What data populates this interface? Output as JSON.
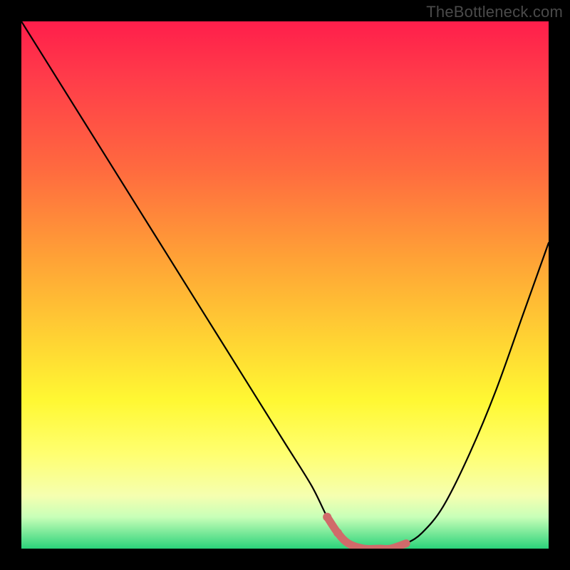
{
  "watermark": "TheBottleneck.com",
  "chart_data": {
    "type": "line",
    "title": "",
    "xlabel": "",
    "ylabel": "",
    "xlim": [
      0,
      100
    ],
    "ylim": [
      0,
      100
    ],
    "grid": false,
    "legend": false,
    "series": [
      {
        "name": "bottleneck-curve",
        "x": [
          0,
          5,
          10,
          15,
          20,
          25,
          30,
          35,
          40,
          45,
          50,
          55,
          58,
          60,
          62,
          65,
          68,
          70,
          73,
          76,
          80,
          85,
          90,
          95,
          100
        ],
        "y": [
          100,
          92,
          84,
          76,
          68,
          60,
          52,
          44,
          36,
          28,
          20,
          12,
          6,
          3,
          1,
          0,
          0,
          0,
          1,
          3,
          8,
          18,
          30,
          44,
          58
        ]
      }
    ],
    "highlight": {
      "name": "optimal-range",
      "color": "#d06a6a",
      "x": [
        58,
        60,
        62,
        65,
        68,
        70,
        73
      ],
      "y": [
        6,
        3,
        1,
        0,
        0,
        0,
        1
      ]
    },
    "gradient_stops": [
      {
        "pos": 0,
        "color": "#ff1e4b"
      },
      {
        "pos": 10,
        "color": "#ff3a4a"
      },
      {
        "pos": 28,
        "color": "#ff6a3f"
      },
      {
        "pos": 45,
        "color": "#ffa236"
      },
      {
        "pos": 60,
        "color": "#ffd233"
      },
      {
        "pos": 72,
        "color": "#fff833"
      },
      {
        "pos": 82,
        "color": "#ffff70"
      },
      {
        "pos": 90,
        "color": "#f5ffb0"
      },
      {
        "pos": 94,
        "color": "#c8ffb8"
      },
      {
        "pos": 100,
        "color": "#2bd37a"
      }
    ]
  }
}
